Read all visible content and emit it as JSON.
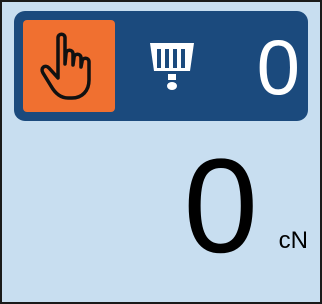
{
  "header": {
    "mode_icon": "hand-pointer-icon",
    "sensor_icon": "comb-sensor-icon",
    "count": "0"
  },
  "reading": {
    "value": "0",
    "unit": "cN"
  },
  "colors": {
    "panel_background": "#c8def0",
    "header_background": "#1b4a7d",
    "active_button": "#f07030",
    "header_text": "#ffffff"
  }
}
